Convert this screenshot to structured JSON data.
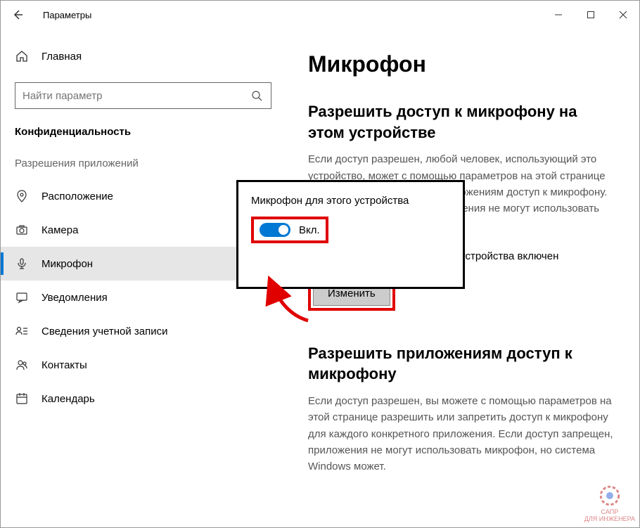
{
  "titlebar": {
    "title": "Параметры"
  },
  "sidebar": {
    "home": "Главная",
    "search_placeholder": "Найти параметр",
    "section": "Конфиденциальность",
    "group": "Разрешения приложений",
    "items": [
      {
        "label": "Расположение"
      },
      {
        "label": "Камера"
      },
      {
        "label": "Микрофон"
      },
      {
        "label": "Уведомления"
      },
      {
        "label": "Сведения учетной записи"
      },
      {
        "label": "Контакты"
      },
      {
        "label": "Календарь"
      }
    ]
  },
  "content": {
    "page_title": "Микрофон",
    "sec1_title": "Разрешить доступ к микрофону на этом устройстве",
    "sec1_desc": "Если доступ разрешен, любой человек, использующий это устройство, может с помощью параметров на этой странице разрешить или запретить приложениям доступ к микрофону. Если доступ запрещен, приложения не могут использовать микрофон.",
    "status": "Доступ к микрофону для этого устройства включен",
    "change_btn": "Изменить",
    "sec2_title": "Разрешить приложениям доступ к микрофону",
    "sec2_desc": "Если доступ разрешен, вы можете с помощью параметров на этой странице разрешить или запретить доступ к микрофону для каждого конкретного приложения. Если доступ запрещен, приложения не могут использовать микрофон, но система Windows может."
  },
  "popup": {
    "title": "Микрофон для этого устройства",
    "toggle_state": "Вкл."
  },
  "watermark": {
    "line1": "САПР",
    "line2": "ДЛЯ ИНЖЕНЕРА"
  }
}
